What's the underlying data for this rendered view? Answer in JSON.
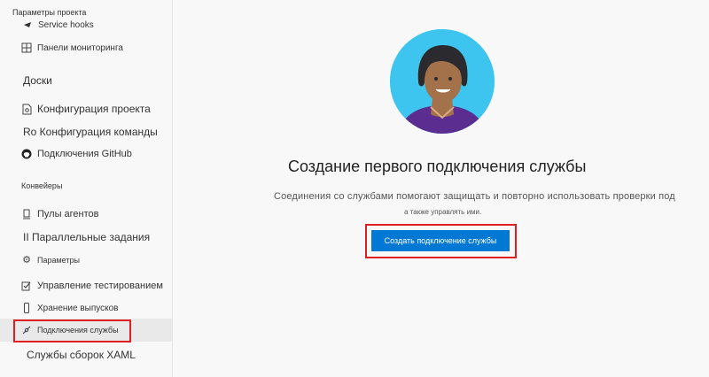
{
  "sidebar": {
    "header": "Параметры проекта",
    "items": [
      {
        "label": "Service hooks",
        "icon": "arrow-icon"
      },
      {
        "label": "Панели мониторинга",
        "icon": "dashboard-icon"
      },
      {
        "label": "Доски",
        "icon": ""
      },
      {
        "label": "Конфигурация проекта",
        "icon": "document-settings-icon"
      },
      {
        "label": "Ro Конфигурация команды",
        "icon": ""
      },
      {
        "label": "Подключения GitHub",
        "icon": "github-icon"
      },
      {
        "label": "Пулы агентов",
        "icon": "agent-pool-icon"
      },
      {
        "label": "II Параллельные задания",
        "icon": ""
      },
      {
        "label": "Параметры",
        "icon": "gear-icon"
      },
      {
        "label": "Управление тестированием",
        "icon": "test-icon"
      },
      {
        "label": "Хранение выпусков",
        "icon": "phone-icon"
      },
      {
        "label": "Подключения службы",
        "icon": "plug-icon"
      },
      {
        "label": "Службы сборок XAML",
        "icon": ""
      }
    ],
    "section_pipelines": "Конвейеры"
  },
  "main": {
    "headline": "Создание первого подключения службы",
    "description_line1": "Соединения со службами помогают защищать и повторно использовать проверки под",
    "description_line2": "а также управлять ими.",
    "create_button": "Создать подключение службы"
  },
  "colors": {
    "accent": "#0078d4",
    "highlight": "#e02020",
    "avatar_bg": "#3dc5ef",
    "shirt": "#5c2d91"
  }
}
